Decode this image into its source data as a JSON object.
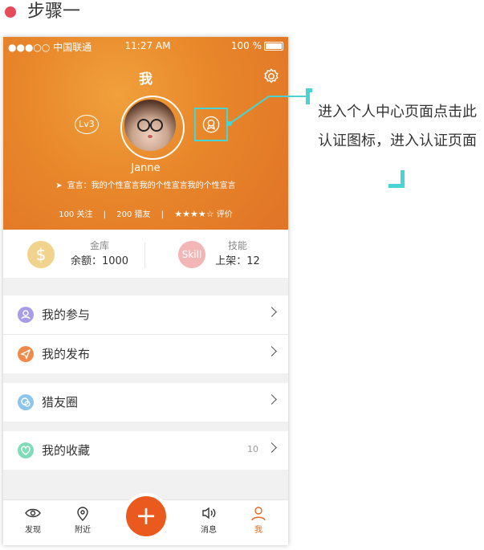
{
  "step": {
    "title": "步骤一"
  },
  "status_bar": {
    "carrier": "●●●○○ 中国联通",
    "time": "11:27 AM",
    "battery": "100 %"
  },
  "header": {
    "title": "我",
    "level": "Lv3",
    "username": "Janne",
    "motto": "宣言：我的个性宣言我的个性宣言我的个性宣言"
  },
  "stats": {
    "following": "100 关注",
    "friends": "200 猎友",
    "rating_label": "评价",
    "rating_stars": 4,
    "rating_max": 5
  },
  "assets": {
    "gold": {
      "icon": "dollar-icon",
      "title": "金库",
      "value": "余额：1000"
    },
    "skill": {
      "icon_text": "Skill",
      "title": "技能",
      "value": "上架：12"
    }
  },
  "menu": {
    "participate": {
      "label": "我的参与",
      "icon": "person-icon",
      "color": "#a89be8"
    },
    "publish": {
      "label": "我的发布",
      "icon": "send-icon",
      "color": "#f08a4b"
    },
    "circle": {
      "label": "猎友圈",
      "icon": "chat-icon",
      "color": "#8ec5ea"
    },
    "favorites": {
      "label": "我的收藏",
      "icon": "heart-icon",
      "color": "#7fdcb8",
      "count": "10"
    }
  },
  "tabbar": {
    "discover": "发现",
    "nearby": "附近",
    "messages": "消息",
    "me": "我",
    "active_color": "#e8641f"
  },
  "annotation": {
    "text": "进入个人中心页面点击此认证图标，进入认证页面",
    "color": "#49d4d4"
  }
}
